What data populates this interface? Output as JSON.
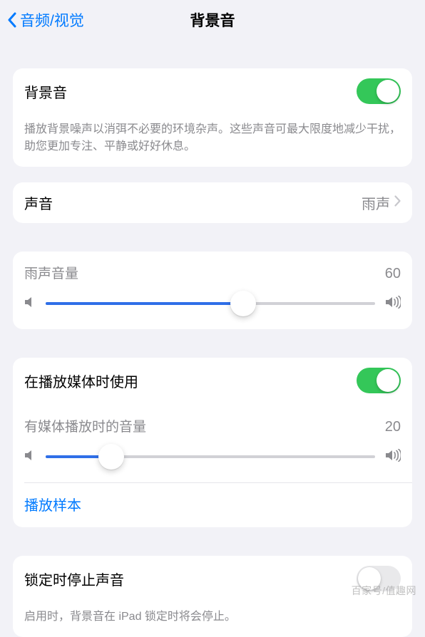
{
  "nav": {
    "back": "音频/视觉",
    "title": "背景音"
  },
  "bg": {
    "label": "背景音",
    "on": true,
    "footer": "播放背景噪声以消弭不必要的环境杂声。这些声音可最大限度地减少干扰，助您更加专注、平静或好好休息。"
  },
  "sound": {
    "label": "声音",
    "value": "雨声"
  },
  "vol1": {
    "title": "雨声音量",
    "value": 60
  },
  "media": {
    "useLabel": "在播放媒体时使用",
    "useOn": true,
    "volTitle": "有媒体播放时的音量",
    "volValue": 20,
    "sample": "播放样本"
  },
  "lock": {
    "label": "锁定时停止声音",
    "on": false,
    "footer": "启用时，背景音在 iPad 锁定时将会停止。"
  },
  "watermark": "百家号/值趣网"
}
